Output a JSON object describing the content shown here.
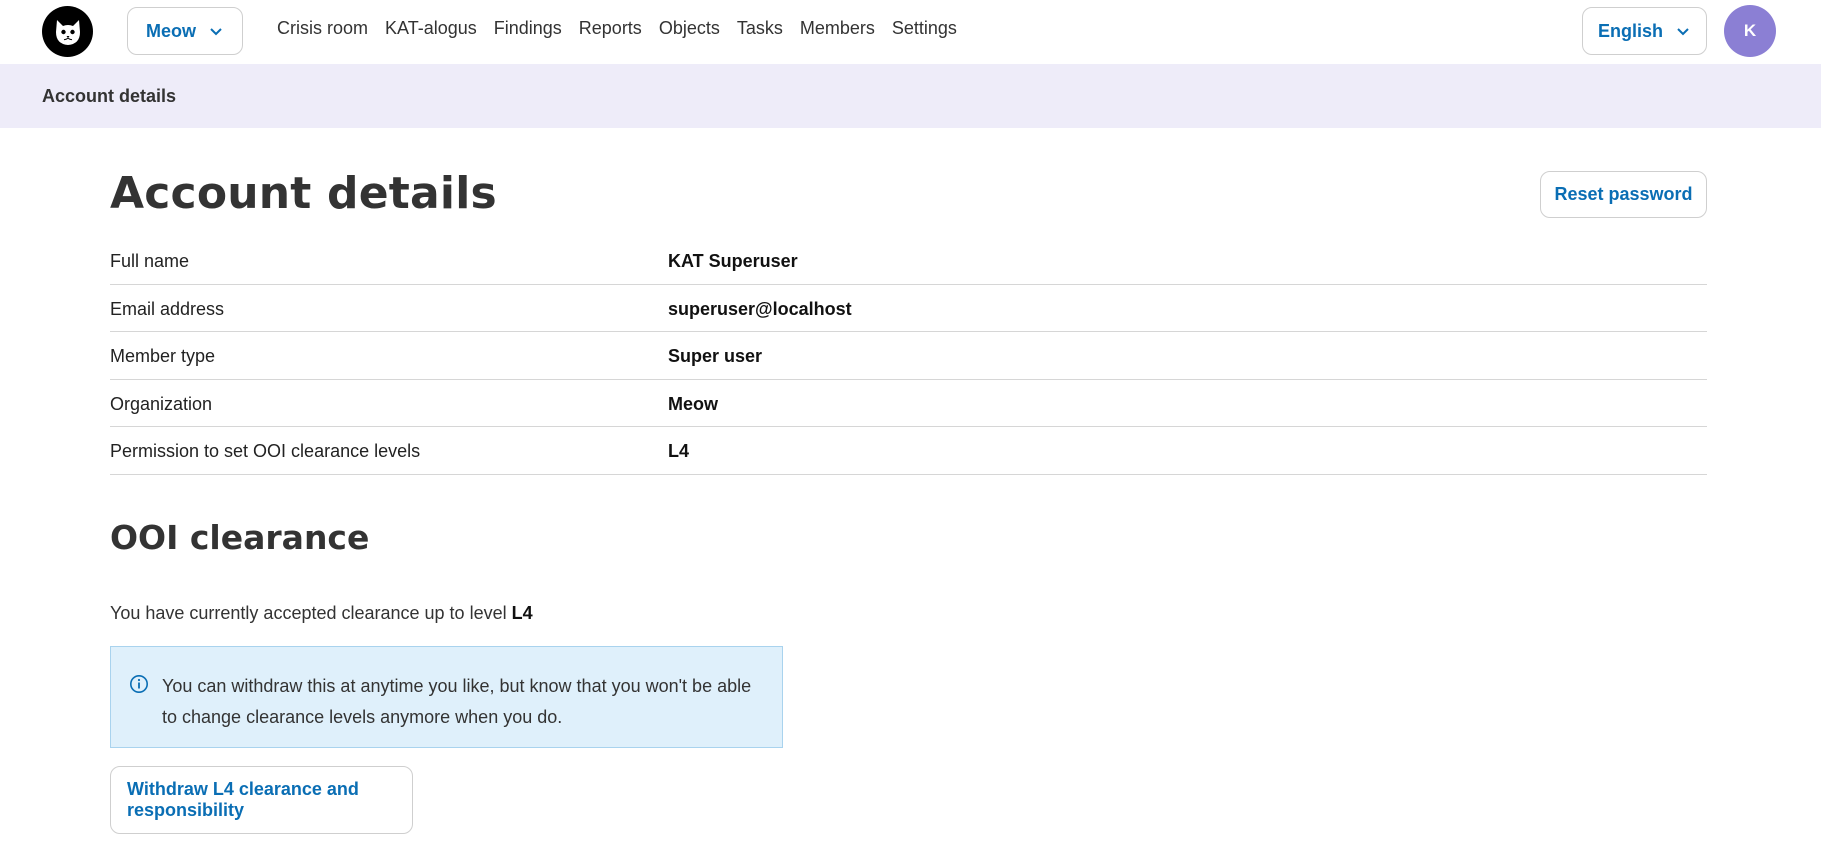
{
  "header": {
    "org_select": "Meow",
    "nav": [
      "Crisis room",
      "KAT-alogus",
      "Findings",
      "Reports",
      "Objects",
      "Tasks",
      "Members",
      "Settings"
    ],
    "language": "English",
    "avatar_initial": "K"
  },
  "breadcrumb": "Account details",
  "page": {
    "title": "Account details",
    "reset_password": "Reset password",
    "details": [
      {
        "label": "Full name",
        "value": "KAT Superuser"
      },
      {
        "label": "Email address",
        "value": "superuser@localhost"
      },
      {
        "label": "Member type",
        "value": "Super user"
      },
      {
        "label": "Organization",
        "value": "Meow"
      },
      {
        "label": "Permission to set OOI clearance levels",
        "value": "L4"
      }
    ]
  },
  "clearance": {
    "title": "OOI clearance",
    "text": "You have currently accepted clearance up to level",
    "level": "L4",
    "info": "You can withdraw this at anytime you like, but know that you won't be able to change clearance levels anymore when you do.",
    "withdraw_button": "Withdraw L4 clearance and responsibility"
  },
  "colors": {
    "accent": "#0a6eb4",
    "avatar": "#8b7fd4",
    "breadcrumb_bg": "#eeecf9",
    "info_bg": "#dff0fb"
  },
  "icons": [
    "cat-logo-icon",
    "chevron-down-icon",
    "info-icon"
  ]
}
